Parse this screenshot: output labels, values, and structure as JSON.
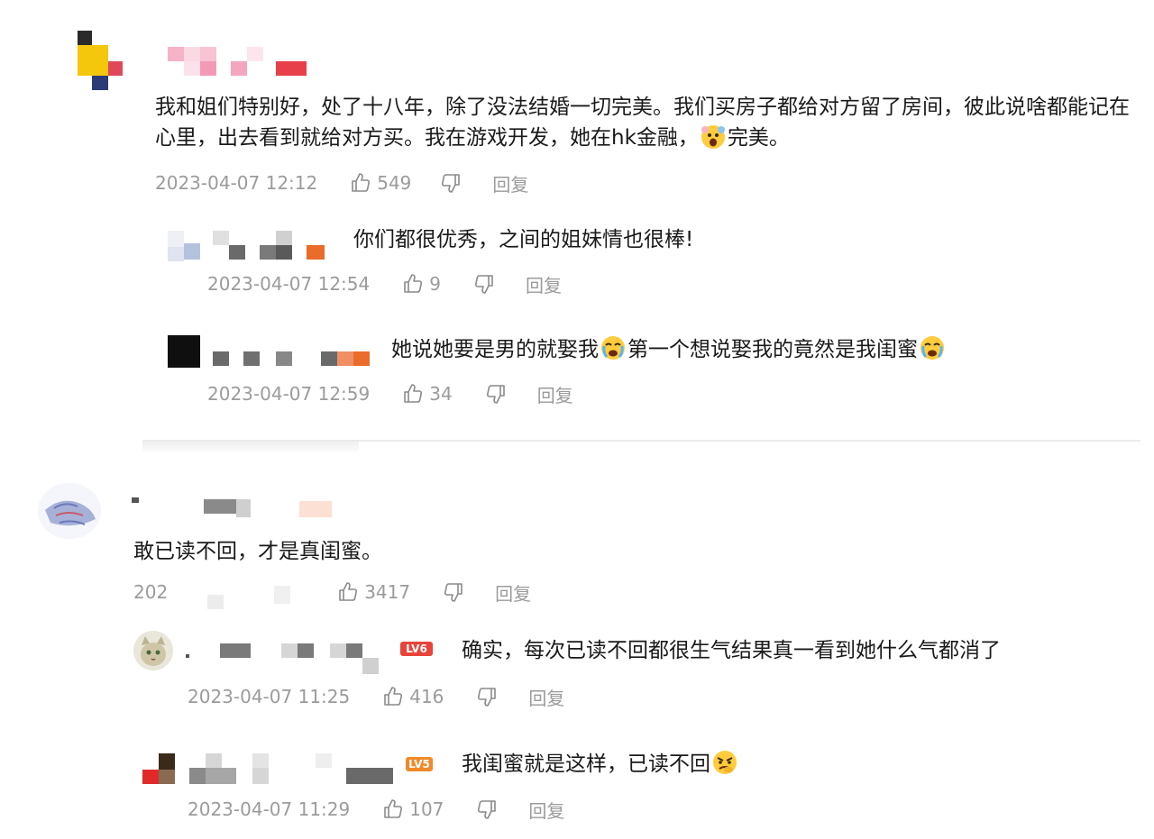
{
  "comments": [
    {
      "text": "我和姐们特别好，处了十八年，除了没法结婚一切完美。我们买房子都给对方留了房间，彼此说啥都能记在心里，出去看到就给对方买。我在游戏开发，她在hk金融，",
      "text_after_emoji": "完美。",
      "emoji": "shocked-face-emoji",
      "time": "2023-04-07 12:12",
      "likes": "549",
      "reply_label": "回复",
      "replies": [
        {
          "text": "你们都很优秀，之间的姐妹情也很棒!",
          "time": "2023-04-07 12:54",
          "likes": "9",
          "reply_label": "回复"
        },
        {
          "text_part1": "她说她要是男的就娶我",
          "text_part2": "第一个想说娶我的竟然是我闺蜜",
          "emoji": "crying-face-emoji",
          "time": "2023-04-07 12:59",
          "likes": "34",
          "reply_label": "回复"
        }
      ]
    },
    {
      "text": "敢已读不回，才是真闺蜜。",
      "time": "202",
      "likes": "3417",
      "reply_label": "回复",
      "replies": [
        {
          "level": "LV6",
          "text": "确实，每次已读不回都很生气结果真一看到她什么气都消了",
          "time": "2023-04-07 11:25",
          "likes": "416",
          "reply_label": "回复"
        },
        {
          "level": "LV5",
          "text": "我闺蜜就是这样，已读不回",
          "emoji": "angry-face-emoji",
          "time": "2023-04-07 11:29",
          "likes": "107",
          "reply_label": "回复"
        }
      ]
    }
  ],
  "colors": {
    "text": "#1a1a1a",
    "meta": "#9b9b9b",
    "level_red": "#e8443a",
    "level_orange": "#ef8a2a"
  }
}
